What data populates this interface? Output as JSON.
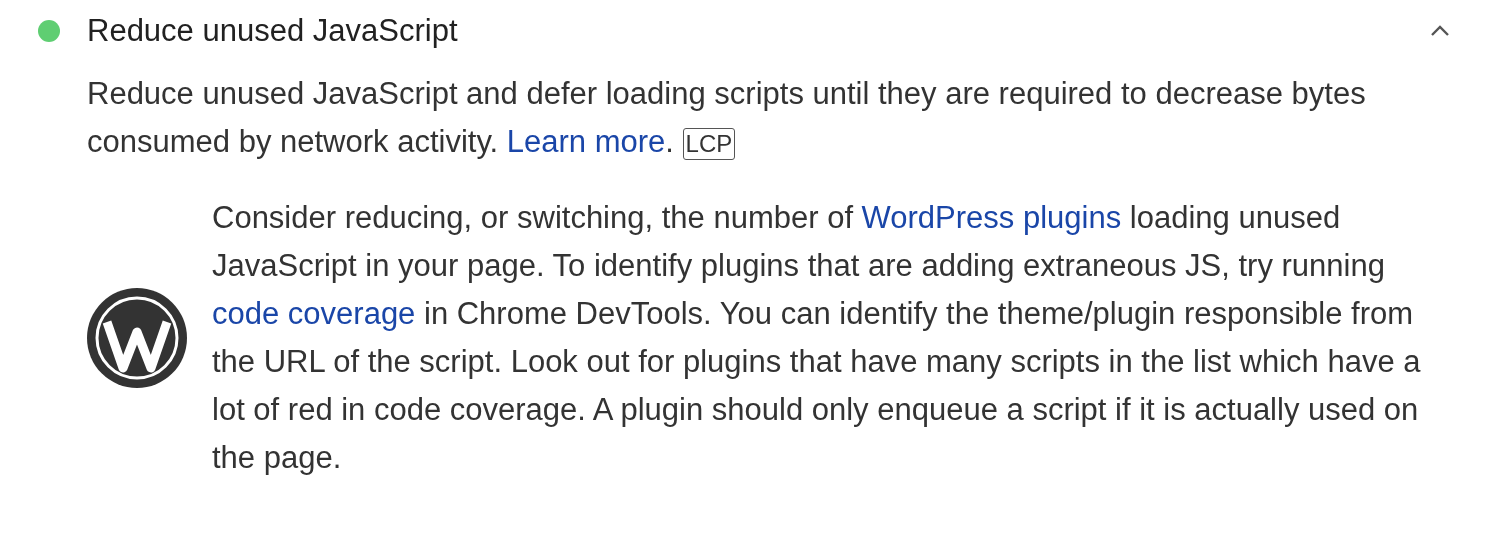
{
  "audit": {
    "title": "Reduce unused JavaScript",
    "color": "#5fce72",
    "expanded": true,
    "description": [
      {
        "kind": "text",
        "text": "Reduce unused JavaScript and defer loading scripts until they are required to decrease bytes consumed by network activity. "
      },
      {
        "kind": "link",
        "text": "Learn more"
      },
      {
        "kind": "text",
        "text": ". "
      },
      {
        "kind": "badge",
        "text": "LCP"
      }
    ],
    "stack_pack": [
      {
        "kind": "text",
        "text": "Consider reducing, or switching, the number of "
      },
      {
        "kind": "link",
        "text": "WordPress plugins"
      },
      {
        "kind": "text",
        "text": " loading unused JavaScript in your page. To identify plugins that are adding extraneous JS, try running "
      },
      {
        "kind": "link",
        "text": "code coverage"
      },
      {
        "kind": "text",
        "text": " in Chrome DevTools. You can identify the theme/plugin responsible from the URL of the script. Look out for plugins that have many scripts in the list which have a lot of red in code coverage. A plugin should only enqueue a script if it is actually used on the page."
      }
    ]
  }
}
